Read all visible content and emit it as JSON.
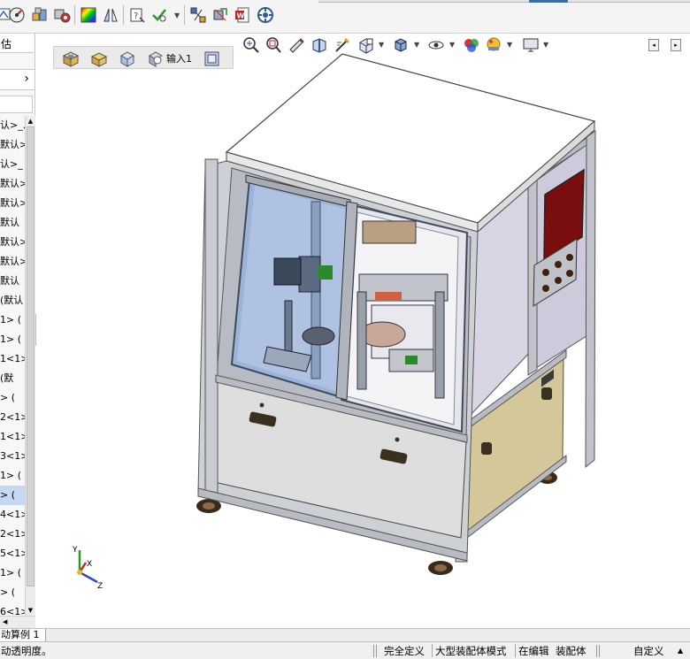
{
  "toolbar": {
    "icons": [
      "gauge-icon",
      "parts-icon",
      "assembly-icon",
      "color-spectrum-icon",
      "flip-icon",
      "help-doc-icon",
      "check-edit-icon",
      "dropdown-icon",
      "explode-icon",
      "move-icon",
      "word-icon",
      "plugin-icon"
    ]
  },
  "left_panel": {
    "tab_label": "估",
    "rows": [
      "认>_...",
      "默认>",
      "认>_",
      "默认>",
      "默认>",
      "默认",
      "默认>",
      "默认>",
      "默认",
      "(默认",
      "1> (",
      "1> (",
      "1<1>",
      "(默",
      "> (",
      "2<1>",
      "1<1>",
      "3<1>",
      "1> (",
      "> (",
      "4<1>",
      "2<1>",
      "5<1>",
      "1> (",
      "> (",
      "6<1>"
    ],
    "selected_index": 19
  },
  "viewport": {
    "breadcrumb": [
      "assembly-root-icon",
      "subassembly-icon",
      "part-icon",
      "feature-icon",
      "sketch-icon"
    ],
    "breadcrumb_label": "输入1",
    "hud_icons": [
      "zoom-to-fit-icon",
      "zoom-area-icon",
      "previous-view-icon",
      "section-view-icon",
      "dynamic-annotation-icon",
      "view-orientation-icon",
      "display-style-icon",
      "hide-show-icon",
      "edit-appearance-icon",
      "apply-scene-icon",
      "view-settings-icon"
    ],
    "triad": {
      "x": "X",
      "y": "Y",
      "z": "Z"
    },
    "colors": {
      "frame": "#b8bcc2",
      "panel": "#d8d6e4",
      "lower_panel": "#d4c79a",
      "glass": "#9cb4d8",
      "top": "#ffffff",
      "screen": "#8a1010"
    }
  },
  "bottom_tab": {
    "label": "动算例 1"
  },
  "status_bar": {
    "message": "动透明度。",
    "fully_defined": "完全定义",
    "large_assembly_mode": "大型装配体模式",
    "editing": "在编辑",
    "editing_target": "装配体",
    "custom": "自定义"
  }
}
